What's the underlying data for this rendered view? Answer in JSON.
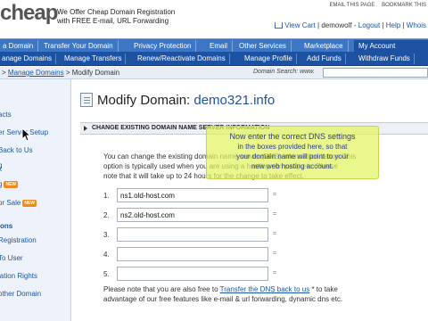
{
  "header": {
    "logo_text": "cheap",
    "tagline_line1": "We Offer Cheap Domain Registration",
    "tagline_line2": "with FREE E-mail, URL Forwarding",
    "email_page": "EMAIL THIS PAGE",
    "bookmark": "BOOKMARK THIS",
    "view_cart": "View Cart",
    "separator": "|",
    "username": "demowolf",
    "logout": "Logout",
    "help": "Help",
    "whois": "Whois"
  },
  "mainnav": {
    "tabs": [
      {
        "label": "a Domain"
      },
      {
        "label": "Transfer Your Domain"
      },
      {
        "label": "Privacy Protection"
      },
      {
        "label": "Email"
      },
      {
        "label": "Other Services"
      },
      {
        "label": "Marketplace"
      },
      {
        "label": "My Account"
      }
    ]
  },
  "subnav": {
    "items": [
      {
        "label": "anage Domains"
      },
      {
        "label": "Manage Transfers"
      },
      {
        "label": "Renew/Reactivate Domains"
      },
      {
        "label": "Manage Profile"
      },
      {
        "label": "Add Funds"
      },
      {
        "label": "Withdraw Funds"
      }
    ]
  },
  "breadcrumb": {
    "prefix": "> ",
    "link": "Manage Domains",
    "current": " > Modify Domain",
    "search_label": "Domain Search: www.",
    "search_value": ""
  },
  "sidebar": {
    "items": [
      {
        "label": "acts"
      },
      {
        "label": "er Server Setup"
      },
      {
        "label": "Back to Us"
      },
      {
        "label": "g"
      },
      {
        "label": "k"
      },
      {
        "label": "g"
      },
      {
        "label": "or Sale"
      },
      {
        "label": "ons"
      },
      {
        "label": "Registration"
      },
      {
        "label": "To User"
      },
      {
        "label": "lation Rights"
      },
      {
        "label": "other Domain"
      }
    ],
    "new_badge": "NEW"
  },
  "main": {
    "title_prefix": "Modify Domain: ",
    "domain": "demo321.info",
    "section_title": "CHANGE EXISTING DOMAIN NAME SERVER INFORMATION",
    "desc_line1": "You can change the existing domain name server (DNS) information below. This",
    "desc_line2": "option is typically used when you are using a hosting company etc. Please",
    "desc_line3": "note that it will take up to 24 hours for the change to take effect.",
    "ns": [
      {
        "num": "1.",
        "value": "ns1.old-host.com"
      },
      {
        "num": "2.",
        "value": "ns2.old-host.com"
      },
      {
        "num": "3.",
        "value": ""
      },
      {
        "num": "4.",
        "value": ""
      },
      {
        "num": "5.",
        "value": ""
      }
    ],
    "ns_eq": "=",
    "note_line1_a": "Please note that you are also free to ",
    "note_link": "Transfer the DNS back to us",
    "note_line1_b": " * to take",
    "note_line2": "advantage of our free features like e-mail & url forwarding, dynamic dns etc."
  },
  "tooltip": {
    "line1": "Now enter the correct DNS settings",
    "line2": "in the boxes provided here, so that",
    "line3": "your domain name will point to your",
    "line4": "new web hosting account."
  },
  "colors": {
    "nav_blue": "#3d76c4",
    "subnav_blue": "#1d52a3",
    "link_blue": "#1a56a8",
    "tooltip_yellow": "#e2f460"
  }
}
